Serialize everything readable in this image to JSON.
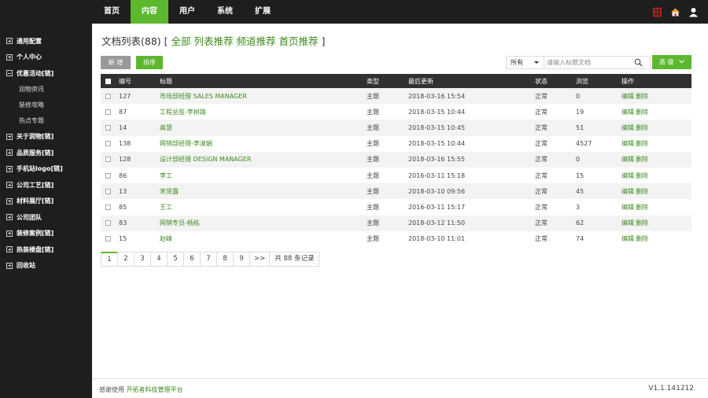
{
  "topnav": [
    {
      "label": "首页",
      "active": false
    },
    {
      "label": "内容",
      "active": true
    },
    {
      "label": "用户",
      "active": false
    },
    {
      "label": "系统",
      "active": false
    },
    {
      "label": "扩展",
      "active": false
    }
  ],
  "top_icons": [
    "book-icon",
    "home-icon",
    "user-icon"
  ],
  "sidebar": {
    "items": [
      {
        "label": "通用配置",
        "expanded": false
      },
      {
        "label": "个人中心",
        "expanded": false
      },
      {
        "label": "优惠活动[链]",
        "expanded": true,
        "children": [
          "润物资讯",
          "装修攻略",
          "热点专题"
        ]
      },
      {
        "label": "关于润物[链]",
        "expanded": false
      },
      {
        "label": "品质服务[链]",
        "expanded": false
      },
      {
        "label": "手机站logo[链]",
        "expanded": false
      },
      {
        "label": "公司工艺[链]",
        "expanded": false
      },
      {
        "label": "材料展厅[链]",
        "expanded": false
      },
      {
        "label": "公司团队",
        "expanded": false
      },
      {
        "label": "装修案例[链]",
        "expanded": false
      },
      {
        "label": "热装楼盘[链]",
        "expanded": false
      },
      {
        "label": "回收站",
        "expanded": false
      }
    ]
  },
  "main": {
    "title_prefix": "文档列表(88) [",
    "title_links": [
      "全部",
      "列表推荐",
      "频道推荐",
      "首页推荐"
    ],
    "title_suffix": "]",
    "btn_new": "新 增",
    "btn_sort": "排序",
    "filter_value": "所有",
    "search_placeholder": "请输入标题文档",
    "btn_advanced": "高 级",
    "columns": [
      "编号",
      "标题",
      "类型",
      "最后更新",
      "状态",
      "浏览",
      "操作"
    ],
    "op_edit": "编辑",
    "op_delete": "删除",
    "rows": [
      {
        "id": "127",
        "title": "市场部经理 SALES MANAGER",
        "type": "主题",
        "updated": "2018-03-16 15:54",
        "status": "正常",
        "views": "0"
      },
      {
        "id": "87",
        "title": "工程总监-李树路",
        "type": "主题",
        "updated": "2018-03-15 10:44",
        "status": "正常",
        "views": "19"
      },
      {
        "id": "14",
        "title": "高慧",
        "type": "主题",
        "updated": "2018-03-15 10:45",
        "status": "正常",
        "views": "51"
      },
      {
        "id": "138",
        "title": "网销部经理-李淑娟",
        "type": "主题",
        "updated": "2018-03-15 10:44",
        "status": "正常",
        "views": "4527"
      },
      {
        "id": "128",
        "title": "设计部经理 DESIGN MANAGER",
        "type": "主题",
        "updated": "2018-03-16 15:55",
        "status": "正常",
        "views": "0"
      },
      {
        "id": "86",
        "title": "李工",
        "type": "主题",
        "updated": "2016-03-11 15:18",
        "status": "正常",
        "views": "15"
      },
      {
        "id": "13",
        "title": "宋贤露",
        "type": "主题",
        "updated": "2018-03-10 09:56",
        "status": "正常",
        "views": "45"
      },
      {
        "id": "85",
        "title": "王工",
        "type": "主题",
        "updated": "2016-03-11 15:17",
        "status": "正常",
        "views": "3"
      },
      {
        "id": "83",
        "title": "网销专员-杨栋",
        "type": "主题",
        "updated": "2018-03-12 11:50",
        "status": "正常",
        "views": "62"
      },
      {
        "id": "15",
        "title": "赵峰",
        "type": "主题",
        "updated": "2018-03-10 11:01",
        "status": "正常",
        "views": "74"
      }
    ],
    "pager": {
      "pages": [
        "1",
        "2",
        "3",
        "4",
        "5",
        "6",
        "7",
        "8",
        "9"
      ],
      "current": "1",
      "next": ">>",
      "total": "共 88 条记录"
    }
  },
  "footer": {
    "credit_prefix": "感谢使用",
    "credit_link": "开拓者科技管理平台",
    "version": "V1.1.141212"
  },
  "colors": {
    "accent": "#5cb82e",
    "dark": "#1e1e1e",
    "link": "#3d8b1f"
  }
}
